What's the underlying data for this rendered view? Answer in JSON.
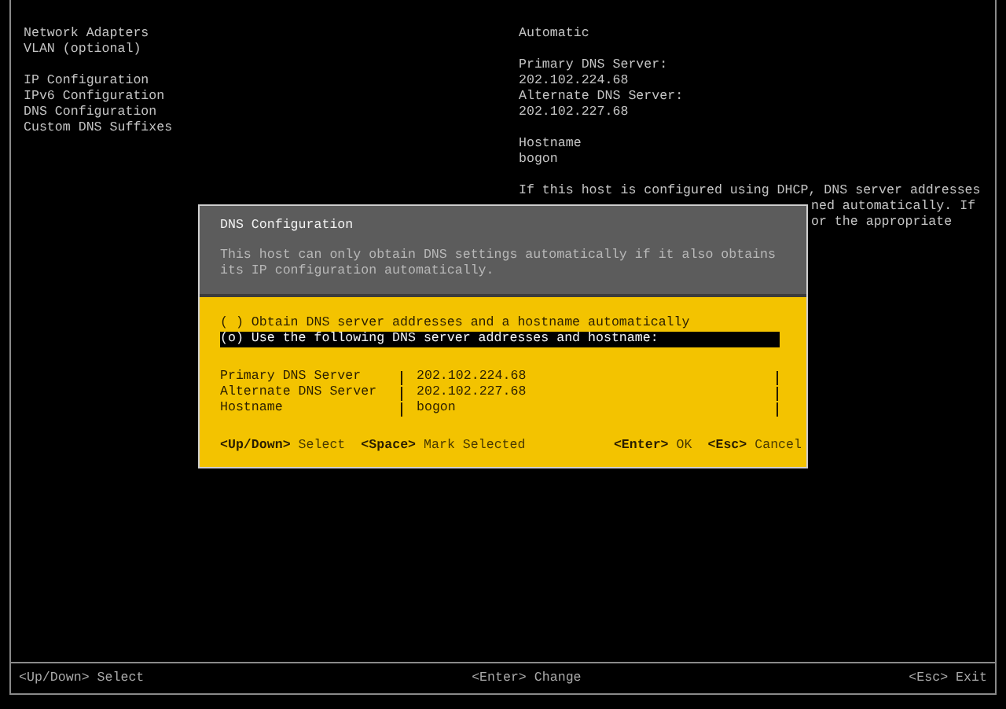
{
  "menu_groups": [
    [
      "Network Adapters",
      "VLAN (optional)"
    ],
    [
      "IP Configuration",
      "IPv6 Configuration",
      "DNS Configuration",
      "Custom DNS Suffixes"
    ]
  ],
  "details": [
    [
      "Automatic"
    ],
    [
      "Primary DNS Server:",
      "202.102.224.68",
      "Alternate DNS Server:",
      "202.102.227.68"
    ],
    [
      "Hostname",
      "bogon"
    ]
  ],
  "help_text": "If this host is configured using DHCP, DNS server addresses",
  "help_text_fragments": [
    "ned automatically. If",
    "or the appropriate"
  ],
  "dialog": {
    "title": "DNS Configuration",
    "description": "This host can only obtain DNS settings automatically if it also obtains its IP configuration automatically.",
    "options": [
      {
        "marker": "( )",
        "label": "Obtain DNS server addresses and a hostname automatically",
        "selected": false
      },
      {
        "marker": "(o)",
        "label": "Use the following DNS server addresses and hostname:",
        "selected": true
      }
    ],
    "fields": [
      {
        "label": "Primary DNS Server",
        "value": "202.102.224.68"
      },
      {
        "label": "Alternate DNS Server",
        "value": "202.102.227.68"
      },
      {
        "label": "Hostname",
        "value": "bogon"
      }
    ],
    "hints_left": [
      {
        "key": "<Up/Down>",
        "action": "Select"
      },
      {
        "key": "<Space>",
        "action": "Mark Selected"
      }
    ],
    "hints_right": [
      {
        "key": "<Enter>",
        "action": "OK"
      },
      {
        "key": "<Esc>",
        "action": "Cancel"
      }
    ]
  },
  "footer": [
    {
      "key": "<Up/Down>",
      "action": "Select"
    },
    {
      "key": "<Enter>",
      "action": "Change"
    },
    {
      "key": "<Esc>",
      "action": "Exit"
    }
  ]
}
